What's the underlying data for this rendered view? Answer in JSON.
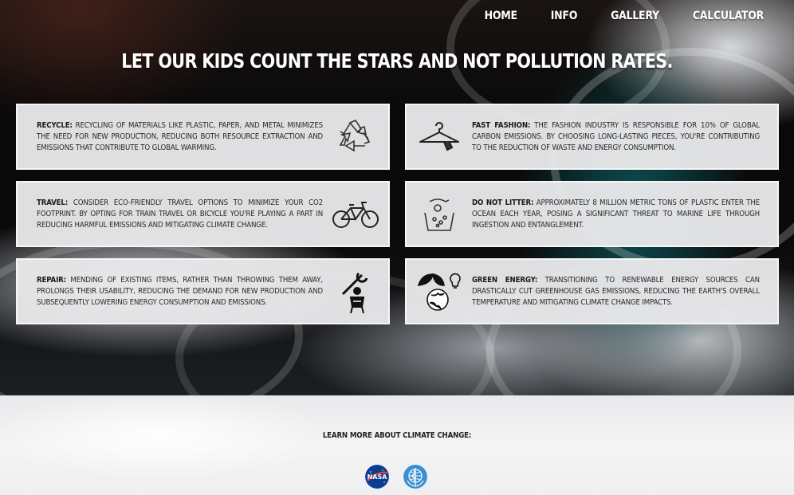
{
  "nav": {
    "items": [
      {
        "label": "HOME"
      },
      {
        "label": "INFO"
      },
      {
        "label": "GALLERY"
      },
      {
        "label": "CALCULATOR"
      }
    ]
  },
  "headline": "LET OUR KIDS COUNT THE STARS AND NOT POLLUTION RATES.",
  "cards": [
    {
      "title": "RECYCLE:",
      "text": "RECYCLING OF MATERIALS LIKE PLASTIC, PAPER, AND METAL MINIMIZES THE NEED FOR NEW PRODUCTION, REDUCING BOTH RESOURCE EXTRACTION AND EMISSIONS THAT CONTRIBUTE TO GLOBAL WARMING.",
      "icon": "recycle-icon"
    },
    {
      "title": "FAST FASHION:",
      "text": "THE FASHION INDUSTRY IS RESPONSIBLE FOR 10% OF GLOBAL CARBON EMISSIONS. BY CHOOSING LONG-LASTING PIECES, YOU'RE CONTRIBUTING TO THE REDUCTION OF WASTE AND ENERGY CONSUMPTION.",
      "icon": "hanger-icon"
    },
    {
      "title": "TRAVEL:",
      "text": "CONSIDER ECO-FRIENDLY TRAVEL OPTIONS TO MINIMIZE YOUR CO2 FOOTPRINT. BY OPTING FOR TRAIN TRAVEL OR BICYCLE YOU'RE PLAYING A PART IN REDUCING HARMFUL EMISSIONS AND MITIGATING CLIMATE CHANGE.",
      "icon": "bicycle-icon"
    },
    {
      "title": "DO NOT LITTER:",
      "text": "APPROXIMATELY 8 MILLION METRIC TONS OF PLASTIC ENTER THE OCEAN EACH YEAR, POSING A SIGNIFICANT THREAT TO MARINE LIFE THROUGH INGESTION AND ENTANGLEMENT.",
      "icon": "litter-bin-icon"
    },
    {
      "title": "REPAIR:",
      "text": "MENDING OF EXISTING ITEMS, RATHER THAN THROWING THEM AWAY, PROLONGS THEIR USABILITY, REDUCING THE DEMAND FOR NEW PRODUCTION AND SUBSEQUENTLY LOWERING ENERGY CONSUMPTION AND EMISSIONS.",
      "icon": "wrench-worker-icon"
    },
    {
      "title": "GREEN ENERGY:",
      "text": "TRANSITIONING TO RENEWABLE ENERGY SOURCES CAN DRASTICALLY CUT GREENHOUSE GAS EMISSIONS, REDUCING THE EARTH'S OVERALL TEMPERATURE AND MITIGATING CLIMATE CHANGE IMPACTS.",
      "icon": "earth-leaf-bulb-icon"
    }
  ],
  "footer": {
    "learn_more": "LEARN MORE ABOUT CLIMATE CHANGE:",
    "logos": [
      {
        "name": "nasa-logo",
        "text": "NASA",
        "color": "#0b3d91",
        "accent": "#fc3d21"
      },
      {
        "name": "who-logo",
        "color": "#3b8fd1"
      }
    ]
  }
}
